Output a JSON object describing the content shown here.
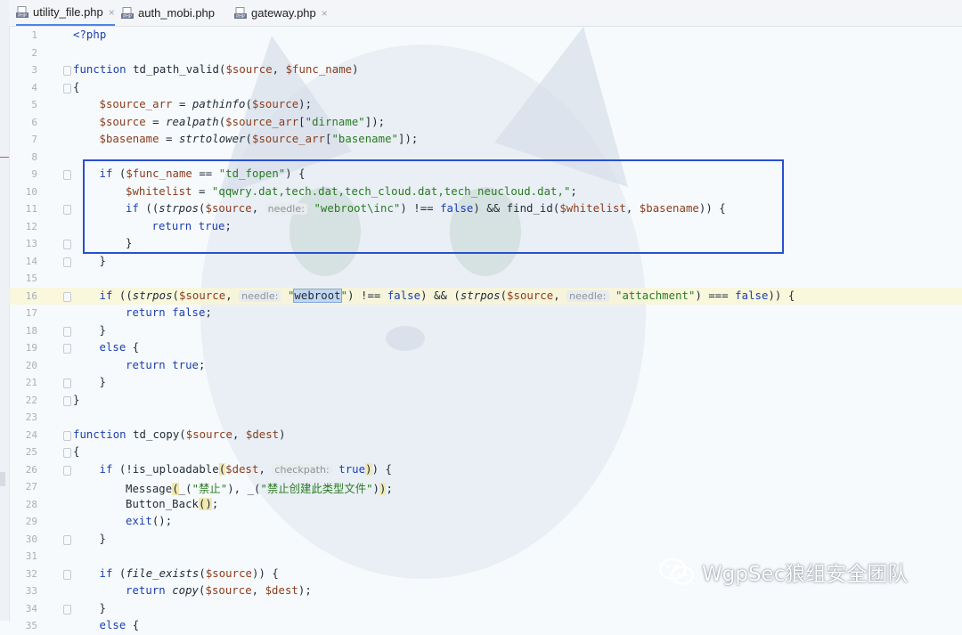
{
  "tabs": [
    {
      "label": "utility_file.php",
      "active": true,
      "close": "×",
      "icon": "php-file-icon"
    },
    {
      "label": "auth_mobi.php",
      "active": false,
      "close": "",
      "icon": "php-file-icon"
    },
    {
      "label": "gateway.php",
      "active": false,
      "close": "×",
      "icon": "php-file-icon"
    }
  ],
  "icon_badge": "PHP",
  "colors": {
    "keyword": "#1a3fb0",
    "variable": "#8a3c1c",
    "string": "#2a7a22",
    "highlight_box": "#2a4fd0"
  },
  "watermark": {
    "icon": "wechat-icon",
    "text": "WgpSec狼组安全团队"
  },
  "lines": [
    {
      "n": "1",
      "indent": 0,
      "tokens": [
        [
          "php",
          "<?php"
        ]
      ]
    },
    {
      "n": "2",
      "indent": 0,
      "tokens": []
    },
    {
      "n": "3",
      "indent": 0,
      "fold": true,
      "tokens": [
        [
          "kw",
          "function "
        ],
        [
          "fn",
          "td_path_valid"
        ],
        [
          "pln",
          "("
        ],
        [
          "var",
          "$source"
        ],
        [
          "pln",
          ", "
        ],
        [
          "var",
          "$func_name"
        ],
        [
          "pln",
          ")"
        ]
      ]
    },
    {
      "n": "4",
      "indent": 0,
      "fold": true,
      "tokens": [
        [
          "pln",
          "{"
        ]
      ]
    },
    {
      "n": "5",
      "indent": 1,
      "tokens": [
        [
          "var",
          "$source_arr"
        ],
        [
          "pln",
          " = "
        ],
        [
          "fi",
          "pathinfo"
        ],
        [
          "pln",
          "("
        ],
        [
          "var",
          "$source"
        ],
        [
          "pln",
          ");"
        ]
      ]
    },
    {
      "n": "6",
      "indent": 1,
      "tokens": [
        [
          "var",
          "$source"
        ],
        [
          "pln",
          " = "
        ],
        [
          "fi",
          "realpath"
        ],
        [
          "pln",
          "("
        ],
        [
          "var",
          "$source_arr"
        ],
        [
          "pln",
          "["
        ],
        [
          "str",
          "\"dirname\""
        ],
        [
          "pln",
          "]);"
        ]
      ]
    },
    {
      "n": "7",
      "indent": 1,
      "tokens": [
        [
          "var",
          "$basename"
        ],
        [
          "pln",
          " = "
        ],
        [
          "fi",
          "strtolower"
        ],
        [
          "pln",
          "("
        ],
        [
          "var",
          "$source_arr"
        ],
        [
          "pln",
          "["
        ],
        [
          "str",
          "\"basename\""
        ],
        [
          "pln",
          "]);"
        ]
      ]
    },
    {
      "n": "8",
      "indent": 0,
      "tokens": []
    },
    {
      "n": "9",
      "indent": 1,
      "fold": true,
      "tokens": [
        [
          "kw",
          "if "
        ],
        [
          "pln",
          "("
        ],
        [
          "var",
          "$func_name"
        ],
        [
          "pln",
          " == "
        ],
        [
          "str",
          "\"td_fopen\""
        ],
        [
          "pln",
          ") {"
        ]
      ]
    },
    {
      "n": "10",
      "indent": 2,
      "tokens": [
        [
          "var",
          "$whitelist"
        ],
        [
          "pln",
          " = "
        ],
        [
          "str",
          "\"qqwry.dat,tech.dat,tech_cloud.dat,tech_neucloud.dat,\""
        ],
        [
          "pln",
          ";"
        ]
      ]
    },
    {
      "n": "11",
      "indent": 2,
      "fold": true,
      "tokens": [
        [
          "kw",
          "if "
        ],
        [
          "pln",
          "(("
        ],
        [
          "fi",
          "strpos"
        ],
        [
          "pln",
          "("
        ],
        [
          "var",
          "$source"
        ],
        [
          "pln",
          ", "
        ],
        [
          "hint",
          "needle:"
        ],
        [
          "pln",
          " "
        ],
        [
          "str",
          "\"webroot\\inc\""
        ],
        [
          "pln",
          ") !== "
        ],
        [
          "bool",
          "false"
        ],
        [
          "pln",
          ") && "
        ],
        [
          "fn",
          "find_id"
        ],
        [
          "pln",
          "("
        ],
        [
          "var",
          "$whitelist"
        ],
        [
          "pln",
          ", "
        ],
        [
          "var",
          "$basename"
        ],
        [
          "pln",
          ")) {"
        ]
      ]
    },
    {
      "n": "12",
      "indent": 3,
      "tokens": [
        [
          "kw",
          "return "
        ],
        [
          "bool",
          "true"
        ],
        [
          "pln",
          ";"
        ]
      ]
    },
    {
      "n": "13",
      "indent": 2,
      "fold": true,
      "tokens": [
        [
          "pln",
          "}"
        ]
      ]
    },
    {
      "n": "14",
      "indent": 1,
      "fold": true,
      "tokens": [
        [
          "pln",
          "}"
        ]
      ]
    },
    {
      "n": "15",
      "indent": 0,
      "tokens": []
    },
    {
      "n": "16",
      "indent": 1,
      "fold": true,
      "hl": true,
      "tokens": [
        [
          "kw",
          "if "
        ],
        [
          "pln",
          "(("
        ],
        [
          "fi",
          "strpos"
        ],
        [
          "pln",
          "("
        ],
        [
          "var",
          "$source"
        ],
        [
          "pln",
          ", "
        ],
        [
          "hint",
          "needle:"
        ],
        [
          "pln",
          " "
        ],
        [
          "str",
          "\""
        ],
        [
          "sel",
          "webroot"
        ],
        [
          "str",
          "\""
        ],
        [
          "pln",
          ") !== "
        ],
        [
          "bool",
          "false"
        ],
        [
          "pln",
          ") && ("
        ],
        [
          "fi",
          "strpos"
        ],
        [
          "pln",
          "("
        ],
        [
          "var",
          "$source"
        ],
        [
          "pln",
          ", "
        ],
        [
          "hint",
          "needle:"
        ],
        [
          "pln",
          " "
        ],
        [
          "str",
          "\"attachment\""
        ],
        [
          "pln",
          ") === "
        ],
        [
          "bool",
          "false"
        ],
        [
          "pln",
          ")) {"
        ]
      ]
    },
    {
      "n": "17",
      "indent": 2,
      "tokens": [
        [
          "kw",
          "return "
        ],
        [
          "bool",
          "false"
        ],
        [
          "pln",
          ";"
        ]
      ]
    },
    {
      "n": "18",
      "indent": 1,
      "fold": true,
      "tokens": [
        [
          "pln",
          "}"
        ]
      ]
    },
    {
      "n": "19",
      "indent": 1,
      "fold": true,
      "tokens": [
        [
          "kw",
          "else "
        ],
        [
          "pln",
          "{"
        ]
      ]
    },
    {
      "n": "20",
      "indent": 2,
      "tokens": [
        [
          "kw",
          "return "
        ],
        [
          "bool",
          "true"
        ],
        [
          "pln",
          ";"
        ]
      ]
    },
    {
      "n": "21",
      "indent": 1,
      "fold": true,
      "tokens": [
        [
          "pln",
          "}"
        ]
      ]
    },
    {
      "n": "22",
      "indent": 0,
      "fold": true,
      "tokens": [
        [
          "pln",
          "}"
        ]
      ]
    },
    {
      "n": "23",
      "indent": 0,
      "tokens": []
    },
    {
      "n": "24",
      "indent": 0,
      "fold": true,
      "tokens": [
        [
          "kw",
          "function "
        ],
        [
          "fn",
          "td_copy"
        ],
        [
          "pln",
          "("
        ],
        [
          "var",
          "$source"
        ],
        [
          "pln",
          ", "
        ],
        [
          "var",
          "$dest"
        ],
        [
          "pln",
          ")"
        ]
      ]
    },
    {
      "n": "25",
      "indent": 0,
      "fold": true,
      "tokens": [
        [
          "pln",
          "{"
        ]
      ]
    },
    {
      "n": "26",
      "indent": 1,
      "fold": true,
      "tokens": [
        [
          "kw",
          "if "
        ],
        [
          "pln",
          "(!"
        ],
        [
          "fn",
          "is_uploadable"
        ],
        [
          "mhl",
          "("
        ],
        [
          "var",
          "$dest"
        ],
        [
          "pln",
          ", "
        ],
        [
          "hint",
          "checkpath:"
        ],
        [
          "pln",
          " "
        ],
        [
          "bool",
          "true"
        ],
        [
          "mhl",
          ")"
        ],
        [
          "pln",
          ") {"
        ]
      ]
    },
    {
      "n": "27",
      "indent": 2,
      "tokens": [
        [
          "fn",
          "Message"
        ],
        [
          "mhl",
          "("
        ],
        [
          "fn",
          "_"
        ],
        [
          "pln",
          "("
        ],
        [
          "str",
          "\"禁止\""
        ],
        [
          "pln",
          "), "
        ],
        [
          "fn",
          "_"
        ],
        [
          "pln",
          "("
        ],
        [
          "str",
          "\"禁止创建此类型文件\""
        ],
        [
          "pln",
          ")"
        ],
        [
          "mhl",
          ")"
        ],
        [
          "pln",
          ";"
        ]
      ]
    },
    {
      "n": "28",
      "indent": 2,
      "tokens": [
        [
          "fn",
          "Button_Back"
        ],
        [
          "mhl",
          "()"
        ],
        [
          "pln",
          ";"
        ]
      ]
    },
    {
      "n": "29",
      "indent": 2,
      "tokens": [
        [
          "kw",
          "exit"
        ],
        [
          "pln",
          "();"
        ]
      ]
    },
    {
      "n": "30",
      "indent": 1,
      "fold": true,
      "tokens": [
        [
          "pln",
          "}"
        ]
      ]
    },
    {
      "n": "31",
      "indent": 0,
      "tokens": []
    },
    {
      "n": "32",
      "indent": 1,
      "fold": true,
      "tokens": [
        [
          "kw",
          "if "
        ],
        [
          "pln",
          "("
        ],
        [
          "fi",
          "file_exists"
        ],
        [
          "pln",
          "("
        ],
        [
          "var",
          "$source"
        ],
        [
          "pln",
          ")) {"
        ]
      ]
    },
    {
      "n": "33",
      "indent": 2,
      "tokens": [
        [
          "kw",
          "return "
        ],
        [
          "fi",
          "copy"
        ],
        [
          "pln",
          "("
        ],
        [
          "var",
          "$source"
        ],
        [
          "pln",
          ", "
        ],
        [
          "var",
          "$dest"
        ],
        [
          "pln",
          ");"
        ]
      ]
    },
    {
      "n": "34",
      "indent": 1,
      "fold": true,
      "tokens": [
        [
          "pln",
          "}"
        ]
      ]
    },
    {
      "n": "35",
      "indent": 1,
      "tokens": [
        [
          "kw",
          "else "
        ],
        [
          "pln",
          "{"
        ]
      ]
    }
  ]
}
